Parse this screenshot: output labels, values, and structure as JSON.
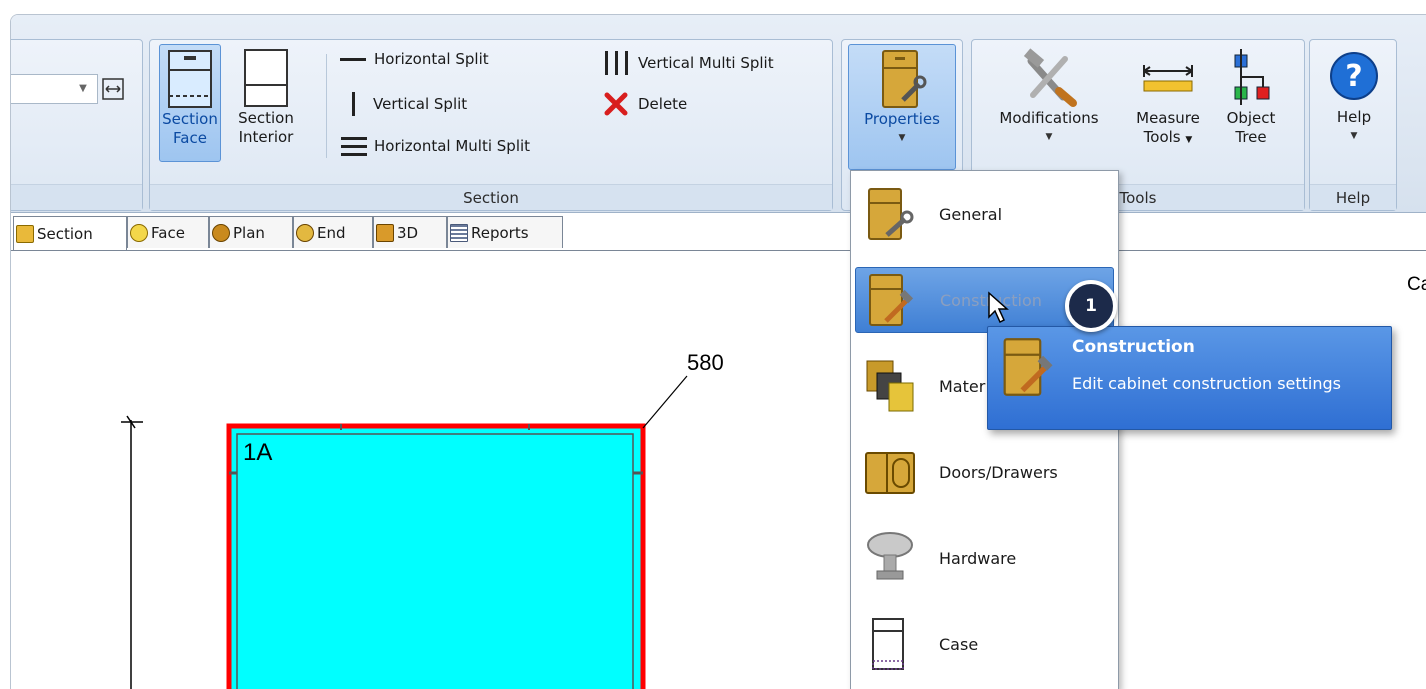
{
  "ribbon": {
    "section_group": {
      "label": "Section",
      "section_face": [
        "Section",
        "Face"
      ],
      "section_interior": [
        "Section",
        "Interior"
      ],
      "horizontal_split": "Horizontal Split",
      "vertical_split": "Vertical Split",
      "horizontal_multi_split": "Horizontal Multi Split",
      "vertical_multi_split": "Vertical Multi Split",
      "delete": "Delete"
    },
    "properties_group": {
      "properties": "Properties"
    },
    "tools_group": {
      "label": "Tools",
      "modifications": "Modifications",
      "measure_tools": [
        "Measure",
        "Tools"
      ],
      "object_tree": [
        "Object",
        "Tree"
      ]
    },
    "help_group": {
      "label": "Help",
      "help": "Help"
    }
  },
  "tabs": [
    "Section",
    "Face",
    "Plan",
    "End",
    "3D",
    "Reports"
  ],
  "canvas": {
    "dimension_label": "580",
    "section_label": "1A",
    "corner_text": "Ca"
  },
  "menu": {
    "items": [
      "General",
      "Construction",
      "Materials",
      "Doors/Drawers",
      "Hardware",
      "Case"
    ],
    "highlighted_index": 1,
    "visible_partial_labels": {
      "construction": "Construction",
      "materials": "Mater"
    }
  },
  "tooltip": {
    "title": "Construction",
    "description": "Edit cabinet construction settings"
  },
  "step_badge": "1",
  "colors": {
    "section_fill": "#00ffff",
    "section_border": "#ff0000",
    "menu_highlight": "#3f7fd4",
    "tooltip_bg": "#2f6fd3",
    "badge_bg": "#1c2a4a"
  }
}
